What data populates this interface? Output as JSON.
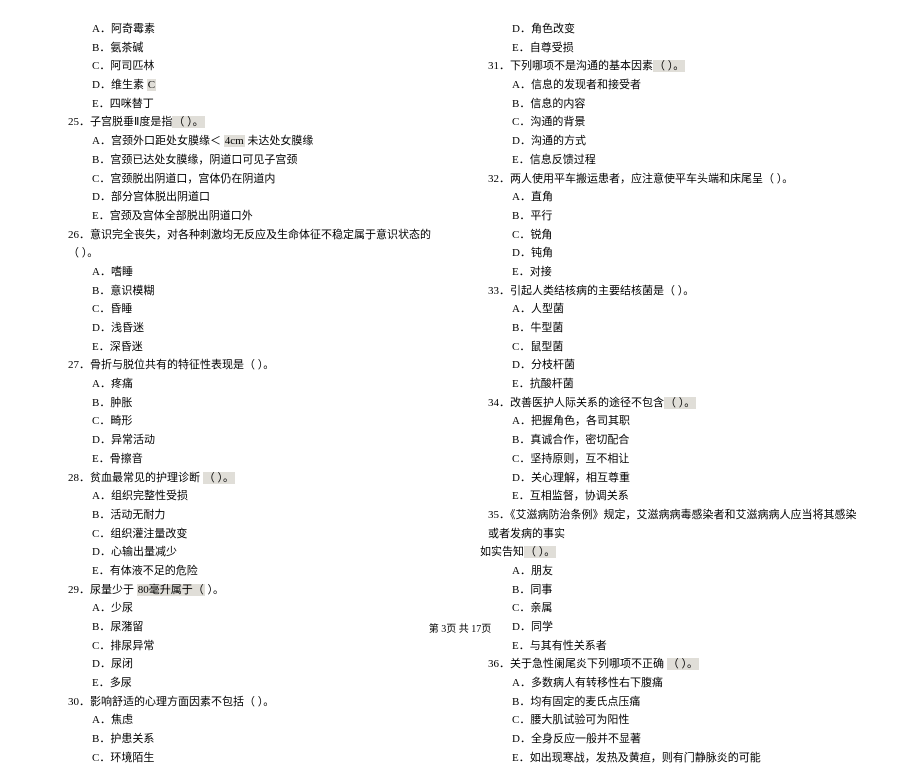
{
  "left": {
    "q24_opts": [
      {
        "L": "A",
        "t": "阿奇霉素"
      },
      {
        "L": "B",
        "t": "氨茶碱"
      },
      {
        "L": "C",
        "t": "阿司匹林"
      },
      {
        "L": "D",
        "t": "维生素",
        "hl": "C"
      },
      {
        "L": "E",
        "t": "四咪替丁"
      }
    ],
    "q25": {
      "num": "25．",
      "stem": "子宫脱垂Ⅱ度是指",
      "tail": "（        ）。"
    },
    "q25_opts": [
      {
        "L": "A",
        "t": "宫颈外口距处女膜缘＜",
        "hl": "4cm",
        "t2": "  未达处女膜缘"
      },
      {
        "L": "B",
        "t": "宫颈已达处女膜缘，阴道口可见子宫颈"
      },
      {
        "L": "C",
        "t": "宫颈脱出阴道口，宫体仍在阴道内"
      },
      {
        "L": "D",
        "t": "部分宫体脱出阴道口"
      },
      {
        "L": "E",
        "t": "宫颈及宫体全部脱出阴道口外"
      }
    ],
    "q26": {
      "num": "26．",
      "stem": "意识完全丧失，对各种刺激均无反应及生命体征不稳定属于意识状态的（              ）。"
    },
    "q26_opts": [
      {
        "L": "A",
        "t": "嗜睡"
      },
      {
        "L": "B",
        "t": "意识模糊"
      },
      {
        "L": "C",
        "t": "昏睡"
      },
      {
        "L": "D",
        "t": "浅昏迷"
      },
      {
        "L": "E",
        "t": "深昏迷"
      }
    ],
    "q27": {
      "num": "27．",
      "stem": "骨折与脱位共有的特征性表现是（          ）。"
    },
    "q27_opts": [
      {
        "L": "A",
        "t": "疼痛"
      },
      {
        "L": "B",
        "t": "肿胀"
      },
      {
        "L": "C",
        "t": "畸形"
      },
      {
        "L": "D",
        "t": "异常活动"
      },
      {
        "L": "E",
        "t": "骨擦音"
      }
    ],
    "q28": {
      "num": "28．",
      "stem": "贫血最常见的护理诊断",
      "tail": "（      ）。"
    },
    "q28_opts": [
      {
        "L": "A",
        "t": "组织完整性受损"
      },
      {
        "L": "B",
        "t": "活动无耐力"
      },
      {
        "L": "C",
        "t": "组织灌注量改变"
      },
      {
        "L": "D",
        "t": "心输出量减少"
      },
      {
        "L": "E",
        "t": "有体液不足的危险"
      }
    ],
    "q29": {
      "num": "29．",
      "stem": "尿量少于",
      "hl": "80毫升属于（",
      "tail": "     ）。"
    },
    "q29_opts": [
      {
        "L": "A",
        "t": "少尿"
      },
      {
        "L": "B",
        "t": "尿潴留"
      },
      {
        "L": "C",
        "t": "排尿异常"
      },
      {
        "L": "D",
        "t": "尿闭"
      },
      {
        "L": "E",
        "t": "多尿"
      }
    ],
    "q30": {
      "num": "30．",
      "stem": "影响舒适的心理方面因素不包括（            ）。"
    },
    "q30_opts": [
      {
        "L": "A",
        "t": "焦虑"
      },
      {
        "L": "B",
        "t": "护患关系"
      },
      {
        "L": "C",
        "t": "环境陌生"
      }
    ]
  },
  "right": {
    "q30_opts_cont": [
      {
        "L": "D",
        "t": "角色改变"
      },
      {
        "L": "E",
        "t": "自尊受损"
      }
    ],
    "q31": {
      "num": "31．",
      "stem": "下列哪项不是沟通的基本因素",
      "tail": "（          ）。"
    },
    "q31_opts": [
      {
        "L": "A",
        "t": "信息的发现者和接受者"
      },
      {
        "L": "B",
        "t": "信息的内容"
      },
      {
        "L": "C",
        "t": "沟通的背景"
      },
      {
        "L": "D",
        "t": "沟通的方式"
      },
      {
        "L": "E",
        "t": "信息反馈过程"
      }
    ],
    "q32": {
      "num": "32．",
      "stem": "两人使用平车搬运患者，应注意使平车头端和床尾呈（           ）。"
    },
    "q32_opts": [
      {
        "L": "A",
        "t": "直角"
      },
      {
        "L": "B",
        "t": "平行"
      },
      {
        "L": "C",
        "t": "锐角"
      },
      {
        "L": "D",
        "t": "钝角"
      },
      {
        "L": "E",
        "t": "对接"
      }
    ],
    "q33": {
      "num": "33．",
      "stem": "引起人类结核病的主要结核菌是（            ）。"
    },
    "q33_opts": [
      {
        "L": "A",
        "t": "人型菌"
      },
      {
        "L": "B",
        "t": "牛型菌"
      },
      {
        "L": "C",
        "t": "鼠型菌"
      },
      {
        "L": "D",
        "t": "分枝杆菌"
      },
      {
        "L": "E",
        "t": "抗酸杆菌"
      }
    ],
    "q34": {
      "num": "34．",
      "stem": "改善医护人际关系的途径不包含",
      "tail": "（          ）。"
    },
    "q34_opts": [
      {
        "L": "A",
        "t": "把握角色，各司其职"
      },
      {
        "L": "B",
        "t": "真诚合作，密切配合"
      },
      {
        "L": "C",
        "t": "坚持原则，互不相让"
      },
      {
        "L": "D",
        "t": "关心理解，相互尊重"
      },
      {
        "L": "E",
        "t": "互相监督，协调关系"
      }
    ],
    "q35": {
      "num": "35．",
      "stem": "《艾滋病防治条例》规定，艾滋病病毒感染者和艾滋病病人应当将其感染或者发病的事实",
      "cont": "如实告知",
      "tail": "（         ）。"
    },
    "q35_opts": [
      {
        "L": "A",
        "t": "朋友"
      },
      {
        "L": "B",
        "t": "同事"
      },
      {
        "L": "C",
        "t": "亲属"
      },
      {
        "L": "D",
        "t": "同学"
      },
      {
        "L": "E",
        "t": "与其有性关系者"
      }
    ],
    "q36": {
      "num": "36．",
      "stem": "关于急性阑尾炎下列哪项不正确",
      "tail": "（      ）。"
    },
    "q36_opts": [
      {
        "L": "A",
        "t": "多数病人有转移性右下腹痛"
      },
      {
        "L": "B",
        "t": "均有固定的麦氏点压痛"
      },
      {
        "L": "C",
        "t": "腰大肌试验可为阳性"
      },
      {
        "L": "D",
        "t": "全身反应一般并不显著"
      },
      {
        "L": "E",
        "t": "如出现寒战，发热及黄疸，则有门静脉炎的可能"
      }
    ]
  },
  "footer": {
    "pre": "第 ",
    "page": "3",
    "mid": "页 共 ",
    "total": "17",
    "post": "页"
  }
}
